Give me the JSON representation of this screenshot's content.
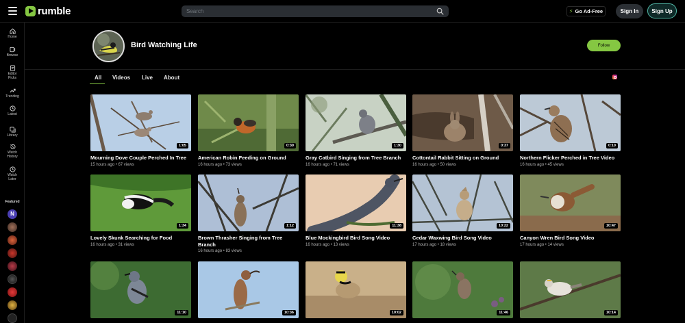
{
  "header": {
    "logo_text": "rumble",
    "search_placeholder": "Search",
    "ad_free_label": "Go Ad-Free",
    "sign_in_label": "Sign In",
    "sign_up_label": "Sign Up"
  },
  "sidebar": {
    "items": [
      {
        "label": "Home",
        "icon": "home-icon"
      },
      {
        "label": "Browse",
        "icon": "browse-icon"
      },
      {
        "label": "Editor Picks",
        "icon": "editor-picks-icon"
      },
      {
        "label": "Trending",
        "icon": "trending-icon"
      },
      {
        "label": "Latest",
        "icon": "latest-icon"
      },
      {
        "label": "Library",
        "icon": "library-icon"
      },
      {
        "label": "Watch History",
        "icon": "watch-history-icon"
      },
      {
        "label": "Watch Later",
        "icon": "watch-later-icon"
      }
    ],
    "featured_label": "Featured"
  },
  "channel": {
    "name": "Bird Watching Life",
    "follow_label": "Follow"
  },
  "tabs": [
    {
      "label": "All"
    },
    {
      "label": "Videos"
    },
    {
      "label": "Live"
    },
    {
      "label": "About"
    }
  ],
  "videos": [
    {
      "title": "Mourning Dove Couple Perched In Tree",
      "time": "15 hours ago",
      "views": "67 views",
      "duration": "1:05"
    },
    {
      "title": "American Robin Feeding on Ground",
      "time": "16 hours ago",
      "views": "73 views",
      "duration": "0:30"
    },
    {
      "title": "Gray Catbird Singing from Tree Branch",
      "time": "16 hours ago",
      "views": "71 views",
      "duration": "1:30"
    },
    {
      "title": "Cottontail Rabbit Sitting on Ground",
      "time": "16 hours ago",
      "views": "50 views",
      "duration": "0:37"
    },
    {
      "title": "Northern Flicker Perched in Tree Video",
      "time": "16 hours ago",
      "views": "45 views",
      "duration": "0:10"
    },
    {
      "title": "Lovely Skunk Searching for Food",
      "time": "16 hours ago",
      "views": "31 views",
      "duration": "1:34"
    },
    {
      "title": "Brown Thrasher Singing from Tree Branch",
      "time": "16 hours ago",
      "views": "83 views",
      "duration": "1:12"
    },
    {
      "title": "Blue Mockingbird Bird Song Video",
      "time": "16 hours ago",
      "views": "13 views",
      "duration": "11:38"
    },
    {
      "title": "Cedar Waxwing Bird Song Video",
      "time": "17 hours ago",
      "views": "18 views",
      "duration": "10:22"
    },
    {
      "title": "Canyon Wren Bird Song Video",
      "time": "17 hours ago",
      "views": "14 views",
      "duration": "10:47"
    },
    {
      "title": "",
      "time": "",
      "views": "",
      "duration": "11:10"
    },
    {
      "title": "",
      "time": "",
      "views": "",
      "duration": "10:36"
    },
    {
      "title": "",
      "time": "",
      "views": "",
      "duration": "10:02"
    },
    {
      "title": "",
      "time": "",
      "views": "",
      "duration": "11:46"
    },
    {
      "title": "",
      "time": "",
      "views": "",
      "duration": "10:14"
    }
  ],
  "colors": {
    "brand_green": "#85c742",
    "background": "#000000",
    "search_bg": "#2a2e33",
    "signup_border": "#52b9a8"
  }
}
